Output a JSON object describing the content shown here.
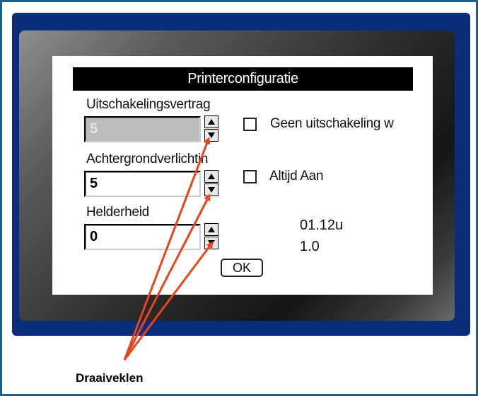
{
  "dialog": {
    "title": "Printerconfiguratie",
    "shutdown_delay": {
      "label": "Uitschakelingsvertrag",
      "value": "5",
      "enabled": false
    },
    "backlight": {
      "label": "Achtergrondverlichtin",
      "value": "5"
    },
    "brightness": {
      "label": "Helderheid",
      "value": "0"
    },
    "no_shutdown": {
      "label": "Geen uitschakeling w",
      "checked": false
    },
    "always_on": {
      "label": "Altijd Aan",
      "checked": false
    },
    "version_1": "01.12u",
    "version_2": "1.0",
    "ok_label": "OK"
  },
  "annotation": {
    "caption": "Draaiveklen",
    "arrow_color": "#e8451a"
  },
  "colors": {
    "frame_border": "#1f5f8e",
    "bezel": "#0a2d7a",
    "title_bg": "#000000"
  }
}
